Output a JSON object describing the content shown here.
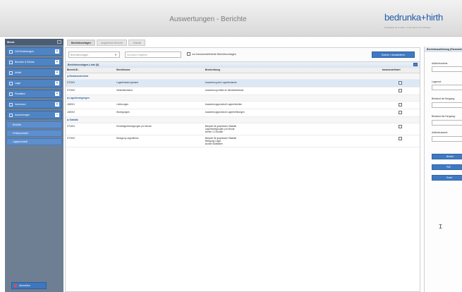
{
  "header": {
    "title": "Auswertungen - Berichte",
    "logo": "bedrunka+hirth",
    "logo_sub": "Workplace ist so alles • mehr Raum zum Arbeiten"
  },
  "sidebar": {
    "title": "Menü",
    "items": [
      {
        "label": "CIM-Einstellungen",
        "icon": "gear-icon"
      },
      {
        "label": "Benutzer & Rechte",
        "icon": "users-icon"
      },
      {
        "label": "Artikel",
        "icon": "box-icon"
      },
      {
        "label": "Lager",
        "icon": "warehouse-icon"
      },
      {
        "label": "Plandaten",
        "icon": "grid-icon"
      },
      {
        "label": "Inventuren",
        "icon": "list-icon"
      },
      {
        "label": "Auswertungen",
        "icon": "chart-icon"
      }
    ],
    "subitems": [
      {
        "label": "Berichte"
      },
      {
        "label": "Fehlerprotokoll"
      },
      {
        "label": "Lagerprotokoll"
      }
    ],
    "logout": "Abmelden"
  },
  "tabs": [
    {
      "label": "Berichtsvorlagen",
      "active": true
    },
    {
      "label": "Ausgeführte Berichte",
      "active": false
    },
    {
      "label": "Statistik",
      "active": false
    }
  ],
  "filter": {
    "select_value": "Berichtsvorlagen",
    "search_placeholder": "Suchwort eingeben",
    "checkbox_label": "nur benutzerdefinierte Berichtsvorlagen",
    "button_label": "Suchen / Aktualisieren"
  },
  "list": {
    "title": "Berichtsvorlagen-Liste (8)",
    "columns": [
      "Bericht-ID ↓",
      "Berichtname",
      "Beschreibung",
      "benutzerdefiniert"
    ],
    "groups": [
      {
        "label": "⊟ Bestandsberichte",
        "rows": [
          {
            "id": "ST0001",
            "name": "Lagerbestand gesamt",
            "desc": "Auswertung des Lagerbestands",
            "selected": true
          },
          {
            "id": "ST0002",
            "name": "Mindestbestand",
            "desc": "Auswertung mittels im Mindestbestand",
            "selected": false
          }
        ]
      },
      {
        "label": "⊟ Lagerbewegungen",
        "rows": [
          {
            "id": "LB0001",
            "name": "Lieferungen",
            "desc": "Auswertungsprotokoll Lagereinheiten",
            "selected": false
          },
          {
            "id": "LB0002",
            "name": "Bewegungen",
            "desc": "Auswertungsprotokoll Lagerbefüllungen",
            "selected": false
          }
        ]
      },
      {
        "label": "⊟ Statistik",
        "rows": [
          {
            "id": "ST4001",
            "name": "Einzellagerbewegungen pro Monat",
            "desc": "Beispiel für graphische Statistik\nLagerbewegungen pro Monat\nletzten 12 Monate",
            "selected": false
          },
          {
            "id": "ST4002",
            "name": "Belegung Lagerfächer",
            "desc": "Beispiel für graphische Statistik\nBelegung Lager\nanzahl Statistiken",
            "selected": false
          }
        ]
      }
    ]
  },
  "right_panel": {
    "title": "Berichtsausführung (Parameter)",
    "fields": [
      {
        "label": "Artikelnummer:"
      },
      {
        "label": "Lagerort:"
      },
      {
        "label": "Bestand ab Hergang:"
      },
      {
        "label": "Bestand bis Hergang:"
      },
      {
        "label": "Artikelzustand:"
      }
    ],
    "buttons": [
      {
        "label": "Bericht"
      },
      {
        "label": "PDF"
      },
      {
        "label": "Excel"
      }
    ]
  }
}
